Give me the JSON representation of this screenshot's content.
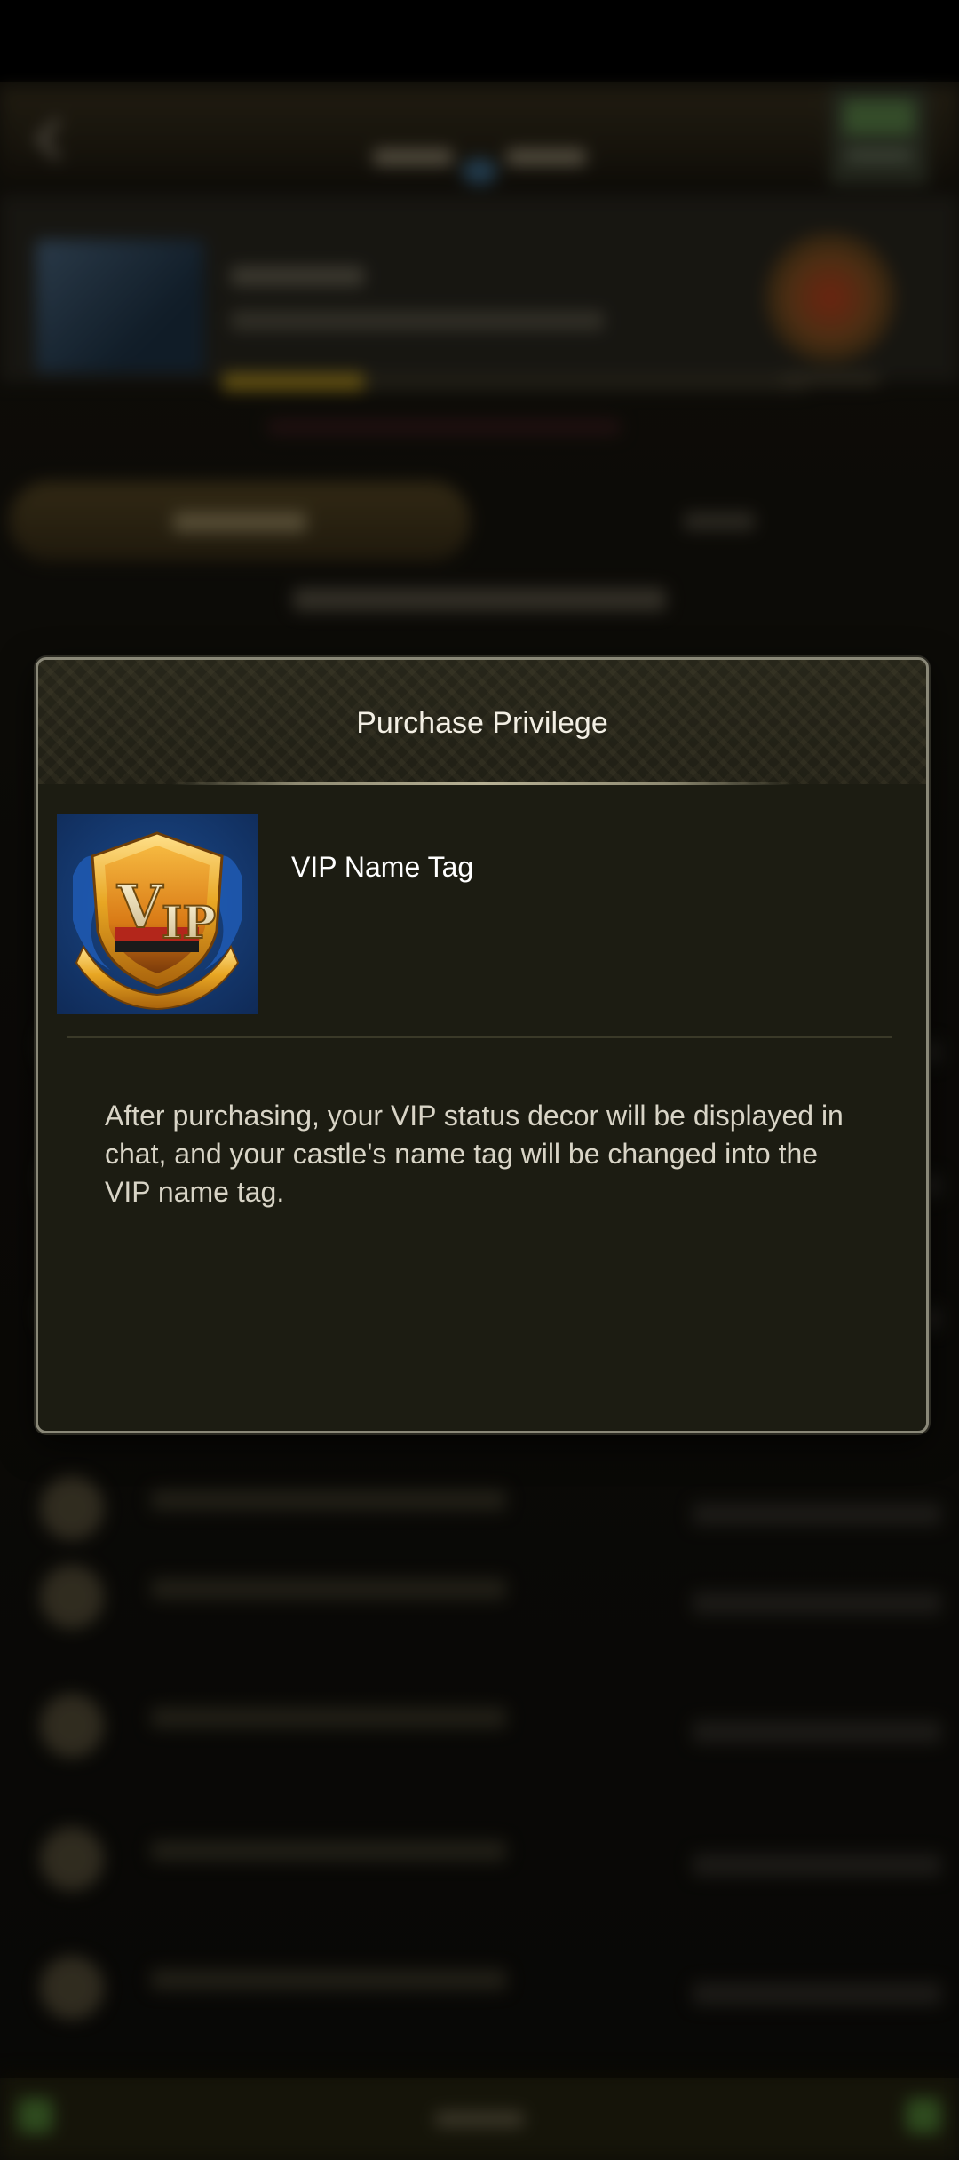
{
  "modal": {
    "title": "Purchase Privilege",
    "item_name": "VIP Name Tag",
    "item_icon": "vip-badge-icon",
    "description": "After purchasing, your VIP status decor will be displayed in chat, and your castle's name tag will be changed into the VIP name tag."
  }
}
